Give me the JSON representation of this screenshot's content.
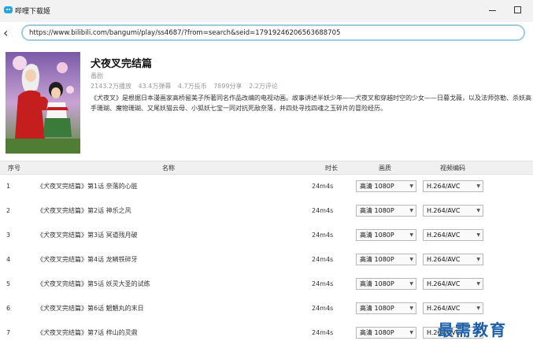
{
  "window": {
    "title": "哔哩下载姬"
  },
  "address_bar": {
    "url": "https://www.bilibili.com/bangumi/play/ss4687/?from=search&seid=17919246206563688705"
  },
  "show": {
    "title": "犬夜叉完结篇",
    "subtitle": "番剧",
    "stats": [
      "2143.2万播放",
      "43.4万弹幕",
      "4.7万投币",
      "7899分享",
      "2.2万评论"
    ],
    "description": "《犬夜叉》是根据日本漫画家高桥留美子所著同名作品改编的电视动画。故事讲述半妖少年——犬夜叉和穿越时空的少女——日暮戈薇，以及法师弥勒、杀妖高手珊瑚、魔物珊瑚、又尾妖猫云母、小狐妖七宝一同对抗死敌奈落，并四处寻找四魂之玉碎片的冒险经历。"
  },
  "table": {
    "headers": {
      "index": "序号",
      "name": "名称",
      "duration": "时长",
      "quality": "画质",
      "codec": "视频编码"
    },
    "rows": [
      {
        "index": "1",
        "name": "《犬夜叉完结篇》第1话 奈落的心脏",
        "duration": "24m4s",
        "quality": "高清 1080P",
        "codec": "H.264/AVC"
      },
      {
        "index": "2",
        "name": "《犬夜叉完结篇》第2话 神乐之风",
        "duration": "24m4s",
        "quality": "高清 1080P",
        "codec": "H.264/AVC"
      },
      {
        "index": "3",
        "name": "《犬夜叉完结篇》第3话 冥道残月破",
        "duration": "24m4s",
        "quality": "高清 1080P",
        "codec": "H.264/AVC"
      },
      {
        "index": "4",
        "name": "《犬夜叉完结篇》第4话 龙鳞铁碎牙",
        "duration": "24m4s",
        "quality": "高清 1080P",
        "codec": "H.264/AVC"
      },
      {
        "index": "5",
        "name": "《犬夜叉完结篇》第5话 妖灵大圣的试练",
        "duration": "24m4s",
        "quality": "高清 1080P",
        "codec": "H.264/AVC"
      },
      {
        "index": "6",
        "name": "《犬夜叉完结篇》第6话 魍魉丸的末日",
        "duration": "24m4s",
        "quality": "高清 1080P",
        "codec": "H.264/AVC"
      },
      {
        "index": "7",
        "name": "《犬夜叉完结篇》第7话 梓山的灵鼎",
        "duration": "24m4s",
        "quality": "高清 1080P",
        "codec": "H.264/AVC"
      }
    ]
  },
  "watermark": {
    "text": "最需教育"
  }
}
